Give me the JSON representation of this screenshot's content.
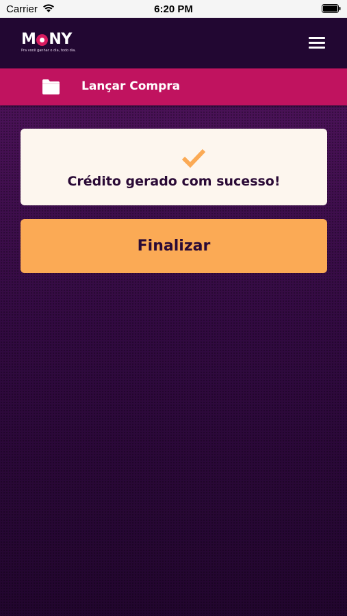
{
  "status_bar": {
    "carrier": "Carrier",
    "time": "6:20 PM"
  },
  "header": {
    "logo_text_left": "M",
    "logo_text_right": "NY",
    "tagline": "Pra você ganhar o dia, todo dia.",
    "menu_icon": "hamburger-menu-icon"
  },
  "section": {
    "icon": "folder-icon",
    "title": "Lançar Compra"
  },
  "card": {
    "icon": "checkmark-icon",
    "message": "Crédito gerado com sucesso!"
  },
  "actions": {
    "finish_label": "Finalizar"
  },
  "colors": {
    "header_bg": "#220732",
    "section_bar": "#c0135f",
    "card_bg": "#fdf6ee",
    "accent_orange": "#fbaa55",
    "text_dark": "#2a0a36"
  }
}
